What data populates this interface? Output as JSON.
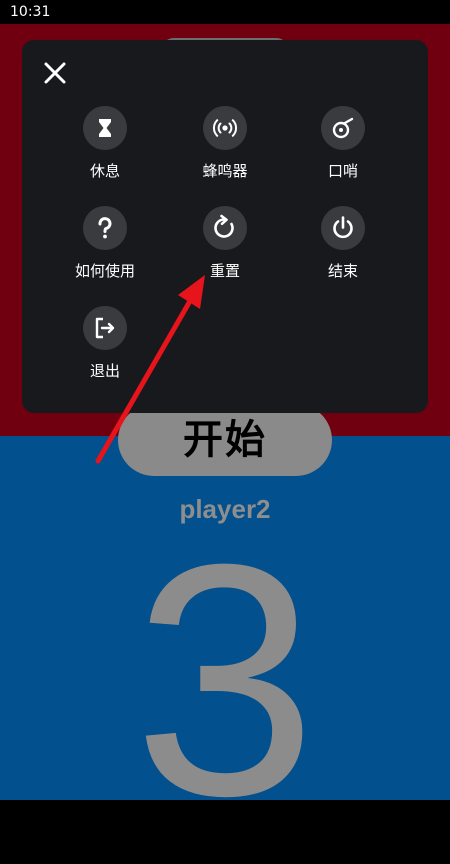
{
  "status_bar": {
    "time": "10:31"
  },
  "menu": {
    "items": [
      {
        "label": "休息",
        "icon": "hourglass-icon"
      },
      {
        "label": "蜂鸣器",
        "icon": "broadcast-icon"
      },
      {
        "label": "口哨",
        "icon": "whistle-icon"
      },
      {
        "label": "如何使用",
        "icon": "question-icon"
      },
      {
        "label": "重置",
        "icon": "refresh-icon"
      },
      {
        "label": "结束",
        "icon": "power-icon"
      },
      {
        "label": "退出",
        "icon": "logout-icon"
      }
    ]
  },
  "game": {
    "start_label": "开始",
    "player_name": "player2",
    "score": "3"
  },
  "colors": {
    "top_half": "#700010",
    "bottom_half": "#02508d",
    "panel": "#18191d",
    "annotation_arrow": "#e8141c"
  }
}
